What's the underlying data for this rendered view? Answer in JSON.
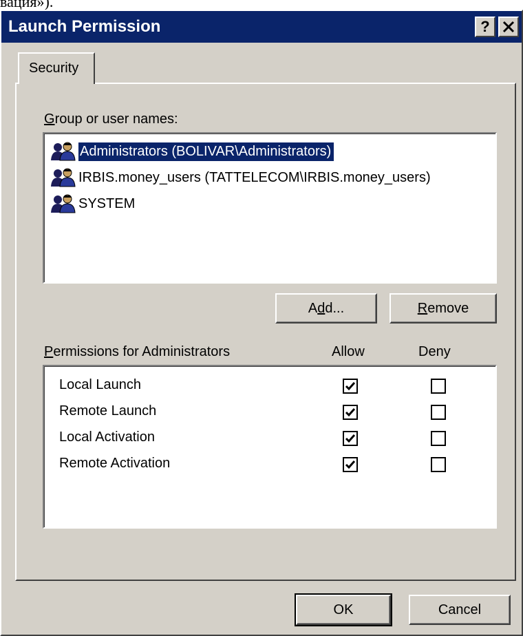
{
  "top_text": "вация»).",
  "window": {
    "title": "Launch Permission",
    "help_button": "?",
    "close_button": "✕"
  },
  "tabs": [
    {
      "label": "Security"
    }
  ],
  "group_section": {
    "label_first": "G",
    "label_rest": "roup or user names:",
    "users": [
      {
        "name": "Administrators (BOLIVAR\\Administrators)",
        "selected": true,
        "icon": "users-group-icon"
      },
      {
        "name": "IRBIS.money_users (TATTELECOM\\IRBIS.money_users)",
        "selected": false,
        "icon": "users-group-icon"
      },
      {
        "name": "SYSTEM",
        "selected": false,
        "icon": "users-group-icon"
      }
    ]
  },
  "buttons": {
    "add_pre": "A",
    "add_key": "d",
    "add_post": "d...",
    "remove_key": "R",
    "remove_rest": "emove",
    "ok": "OK",
    "cancel": "Cancel"
  },
  "permissions": {
    "label_first": "P",
    "label_rest": "ermissions for Administrators",
    "allow_header": "Allow",
    "deny_header": "Deny",
    "items": [
      {
        "name": "Local Launch",
        "allow": true,
        "deny": false
      },
      {
        "name": "Remote Launch",
        "allow": true,
        "deny": false
      },
      {
        "name": "Local Activation",
        "allow": true,
        "deny": false
      },
      {
        "name": "Remote Activation",
        "allow": true,
        "deny": false
      }
    ]
  },
  "colors": {
    "titlebar": "#0a246a",
    "face": "#d4d0c8",
    "selection": "#0a246a"
  }
}
